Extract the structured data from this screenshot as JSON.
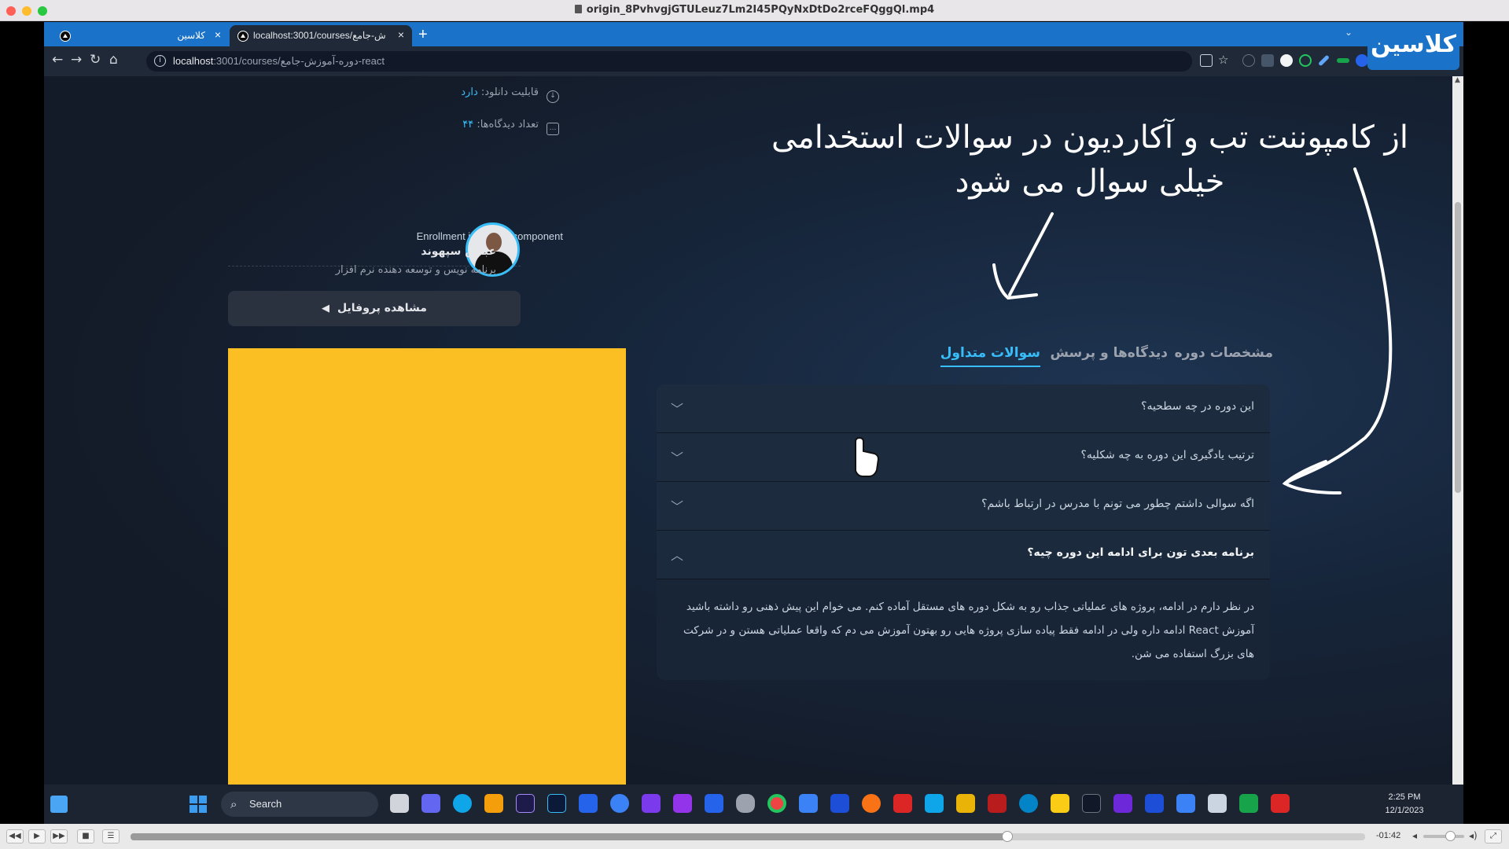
{
  "window": {
    "title": "origin_8PvhvgjGTULeuz7Lm2I45PQyNxDtDo2rceFQggQl.mp4"
  },
  "browser": {
    "tabs": [
      {
        "label": "کلاسین"
      },
      {
        "label": "localhost:3001/courses/ش-جامع"
      }
    ],
    "url_host": "localhost",
    "url_path": ":3001/courses/دوره-آموزش-جامع-react",
    "brand": "کلاسین"
  },
  "course": {
    "download_label": "قابلیت دانلود:",
    "download_value": "دارد",
    "comments_label": "تعداد دیدگاه‌ها:",
    "comments_value": "۴۴",
    "enrollment_text": "Enrollment in course component",
    "teacher_name": "عباس سپهوند",
    "teacher_role": "برنامه نویس و توسعه دهنده نرم افزار",
    "profile_button": "مشاهده پروفایل"
  },
  "tabs": {
    "specs": "مشخصات دوره",
    "comments": "دیدگاه‌ها و پرسش",
    "faq": "سوالات متداول",
    "active": "faq"
  },
  "faq": {
    "items": [
      {
        "question": "این دوره در چه سطحیه؟",
        "open": false
      },
      {
        "question": "ترتیب یادگیری این دوره به چه شکلیه؟",
        "open": false
      },
      {
        "question": "اگه سوالی داشتم چطور می تونم با مدرس در ارتباط باشم؟",
        "open": false
      },
      {
        "question": "برنامه بعدی تون برای ادامه این دوره چیه؟",
        "open": true
      }
    ],
    "answer": "در نظر دارم در ادامه، پروژه های عملیاتی جذاب رو به شکل دوره های مستقل آماده کنم. می خوام این پیش ذهنی رو داشته باشید آموزش React ادامه داره ولی در ادامه فقط پیاده سازی پروژه هایی رو بهتون آموزش می دم که واقعا عملیاتی هستن و در شرکت های بزرگ استفاده می شن."
  },
  "annotation": {
    "line1": "از کامپوننت تب و آکاردیون در سوالات استخدامی",
    "line2": "خیلی سوال می شود"
  },
  "taskbar": {
    "search_label": "Search",
    "time": "2:25 PM",
    "date": "12/1/2023"
  },
  "player": {
    "remaining": "-01:42",
    "progress_fraction": 0.71,
    "volume_fraction": 0.65
  },
  "colors": {
    "accent": "#38bdf8",
    "tab_bar": "#1a73c9",
    "placeholder_block": "#fbbe23"
  }
}
